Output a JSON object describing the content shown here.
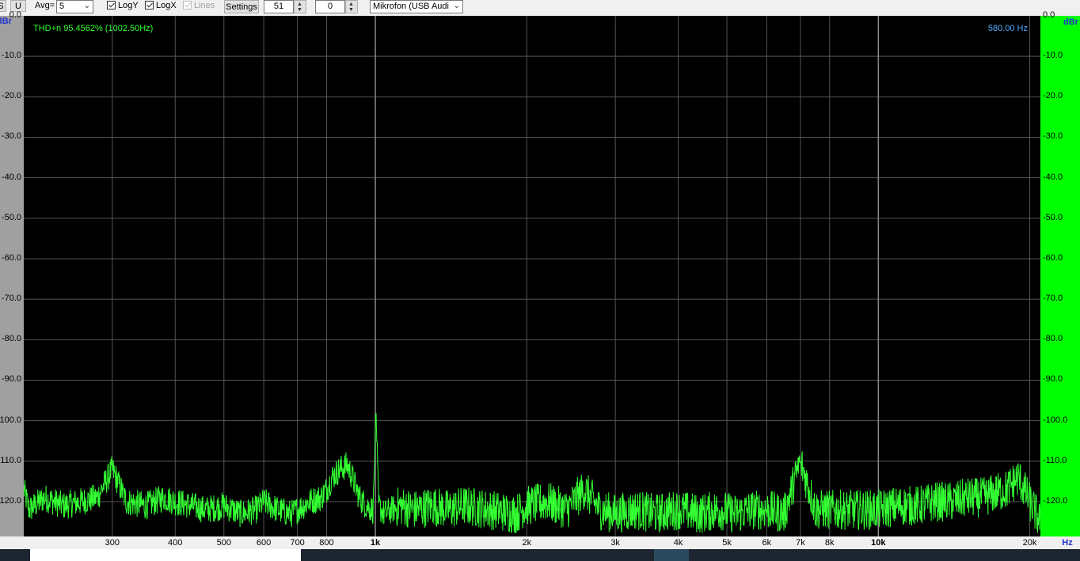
{
  "toolbar": {
    "btn_s": "S",
    "btn_u": "U",
    "avg_label": "Avg=",
    "avg_value": "5",
    "logy_label": "LogY",
    "logx_label": "LogX",
    "lines_label": "Lines",
    "settings_label": "Settings",
    "spin1_value": "51",
    "spin2_value": "0",
    "device_value": "Mikrofon (USB Audi"
  },
  "plot": {
    "thd_text": "THD+n 95.4562% (1002.50Hz)",
    "cursor_freq": "580.00 Hz",
    "left_unit": "dBr",
    "right_unit": "dBr",
    "x_unit": "Hz",
    "colors": {
      "plot_bg": "#000000",
      "trace": "#33ff33",
      "right_axis": "#00ff00",
      "left_axis": "#a0a0a0",
      "grid": "#555555",
      "cursor_text": "#55aaff"
    },
    "left_ticks": [
      "0.0",
      "-10.0",
      "-20.0",
      "-30.0",
      "-40.0",
      "-50.0",
      "-60.0",
      "-70.0",
      "-80.0",
      "-90.0",
      "-100.0",
      "-110.0",
      "-120.0"
    ],
    "right_ticks": [
      "0.0",
      "-10.0",
      "-20.0",
      "-30.0",
      "-40.0",
      "-50.0",
      "-60.0",
      "-70.0",
      "-80.0",
      "-90.0",
      "-100.0",
      "-110.0",
      "-120.0"
    ],
    "x_ticks": [
      {
        "label": "300",
        "f": 300,
        "bold": false
      },
      {
        "label": "400",
        "f": 400,
        "bold": false
      },
      {
        "label": "500",
        "f": 500,
        "bold": false
      },
      {
        "label": "600",
        "f": 600,
        "bold": false
      },
      {
        "label": "700",
        "f": 700,
        "bold": false
      },
      {
        "label": "800",
        "f": 800,
        "bold": false
      },
      {
        "label": "1k",
        "f": 1000,
        "bold": true
      },
      {
        "label": "2k",
        "f": 2000,
        "bold": false
      },
      {
        "label": "3k",
        "f": 3000,
        "bold": false
      },
      {
        "label": "4k",
        "f": 4000,
        "bold": false
      },
      {
        "label": "5k",
        "f": 5000,
        "bold": false
      },
      {
        "label": "6k",
        "f": 6000,
        "bold": false
      },
      {
        "label": "7k",
        "f": 7000,
        "bold": false
      },
      {
        "label": "8k",
        "f": 8000,
        "bold": false
      },
      {
        "label": "10k",
        "f": 10000,
        "bold": true
      },
      {
        "label": "20k",
        "f": 20000,
        "bold": false
      }
    ]
  },
  "chart_data": {
    "type": "line",
    "x_scale": "log",
    "xlim": [
      200,
      21000
    ],
    "ylim": [
      -128.6,
      0
    ],
    "ylabel": "dBr",
    "xlabel": "Hz",
    "series": [
      {
        "x": [
          200,
          205,
          220,
          240,
          260,
          280,
          300,
          320,
          350,
          380,
          400,
          430,
          460,
          500,
          540,
          580,
          600,
          640,
          680,
          700,
          740,
          780,
          800,
          820,
          850,
          880,
          900,
          930,
          960,
          990,
          1002.5,
          1015,
          1040,
          1080,
          1120,
          1200,
          1300,
          1400,
          1500,
          1700,
          1900,
          2000,
          2200,
          2400,
          2600,
          2800,
          3000,
          3300,
          3600,
          4000,
          4400,
          4800,
          5200,
          5600,
          6000,
          6500,
          7000,
          7500,
          8000,
          9000,
          10000,
          11000,
          12000,
          13000,
          14000,
          15000,
          16000,
          17000,
          18000,
          19000,
          20000,
          21000
        ],
        "y": [
          -117,
          -122,
          -119,
          -121,
          -120,
          -119,
          -112,
          -120,
          -121,
          -119,
          -120,
          -121,
          -122,
          -121,
          -123,
          -122,
          -120,
          -122,
          -123,
          -122,
          -120,
          -119,
          -117,
          -114,
          -112,
          -111,
          -114,
          -119,
          -121,
          -122,
          -96.5,
          -121,
          -123,
          -122,
          -121,
          -122,
          -121,
          -122,
          -121,
          -122,
          -123,
          -121,
          -120,
          -122,
          -117,
          -122,
          -123,
          -122,
          -123,
          -122,
          -123,
          -122,
          -123,
          -122,
          -122,
          -123,
          -110,
          -122,
          -122,
          -122,
          -122,
          -121,
          -121,
          -120,
          -120,
          -119,
          -119,
          -118,
          -117,
          -114,
          -120,
          -125
        ]
      }
    ]
  }
}
